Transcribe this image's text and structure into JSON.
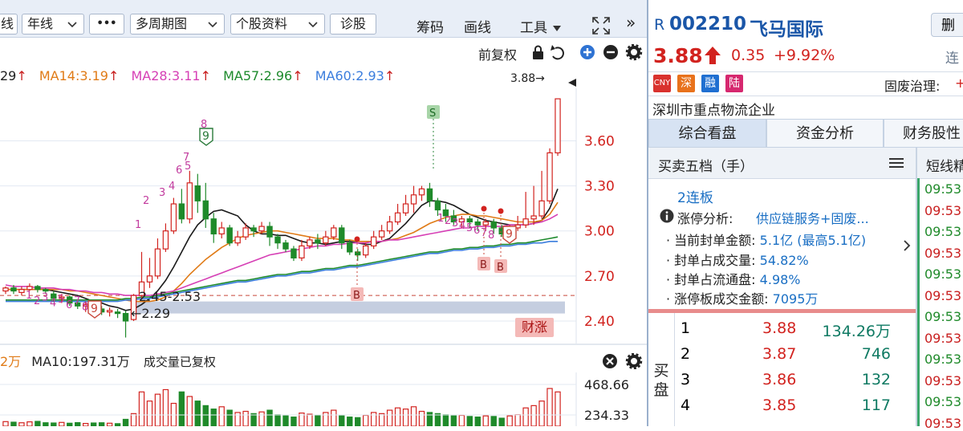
{
  "toolbar": {
    "btn_line_partial": "线",
    "btn_year_line": "年线",
    "btn_more": "•••",
    "btn_multi_period": "多周期图",
    "btn_stock_info": "个股资料",
    "btn_diagnose": "诊股",
    "btn_chips": "筹码",
    "btn_draw": "画线",
    "btn_tools": "工具",
    "btn_collapse": "»"
  },
  "chart_toggle": {
    "restore_label": "前复权"
  },
  "ma": {
    "ma7_partial": "29",
    "ma14": "MA14:3.19",
    "ma28": "MA28:3.11",
    "ma57": "MA57:2.96",
    "ma60": "MA60:2.93",
    "colors": {
      "ma14": "#e07b17",
      "ma28": "#d63fb5",
      "ma57": "#1d8a2c",
      "ma60": "#3b7ddd"
    }
  },
  "price_axis": {
    "ticks": [
      "3.60",
      "3.30",
      "3.00",
      "2.70",
      "2.40"
    ],
    "last_price_label": "3.88→"
  },
  "annotations": {
    "range_label": "2.45-2.53",
    "low_label": "←2.29",
    "cai_zhang": "财涨",
    "seq_left": [
      "1",
      "2",
      "3",
      "4",
      "5",
      "6",
      "7",
      "8",
      "9"
    ],
    "seq_rise": [
      "1",
      "2",
      "3",
      "4",
      "5",
      "6",
      "7",
      "8",
      "9"
    ],
    "seq_right": [
      "1",
      "2",
      "3",
      "4",
      "5",
      "6",
      "7",
      "8",
      "9"
    ],
    "signal_s": "S",
    "signal_b": "B"
  },
  "volume": {
    "ma5_partial": "2万",
    "ma10": "MA10:197.31万",
    "note": "成交量已复权",
    "axis_ticks": [
      "468.66",
      "234.33"
    ]
  },
  "quote": {
    "r_mark": "R",
    "code": "002210",
    "name": "飞马国际",
    "btn_delete": "删",
    "price": "3.88",
    "change": "0.35",
    "change_pct": "+9.92%",
    "lianban_partial": "连",
    "badges": [
      {
        "text": "CNY",
        "color": "#d9322e"
      },
      {
        "text": "深",
        "color": "#e8721c"
      },
      {
        "text": "融",
        "color": "#1f6fd1"
      },
      {
        "text": "陆",
        "color": "#d6286f"
      }
    ],
    "governance_label": "固废治理:",
    "governance_partial": "+",
    "industry": "深圳市重点物流企业"
  },
  "tabs": [
    {
      "label": "综合看盘"
    },
    {
      "label": "资金分析"
    },
    {
      "label": "财务股性"
    }
  ],
  "depth": {
    "title": "买卖五档（手）",
    "lianban": "2连板",
    "limit_analysis_label": "涨停分析:",
    "limit_analysis_value": "供应链服务+固废...",
    "details": [
      {
        "label": "· 当前封单金额:",
        "value": "5.1亿 (最高5.1亿)"
      },
      {
        "label": "· 封单占成交量:",
        "value": "54.82%"
      },
      {
        "label": "· 封单占流通盘:",
        "value": "4.98%"
      },
      {
        "label": "· 涨停板成交金额:",
        "value": "7095万"
      }
    ],
    "buy_side_label": "买盘",
    "orders": [
      {
        "level": "1",
        "price": "3.88",
        "volume": "134.26万"
      },
      {
        "level": "2",
        "price": "3.87",
        "volume": "746"
      },
      {
        "level": "3",
        "price": "3.86",
        "volume": "132"
      },
      {
        "level": "4",
        "price": "3.85",
        "volume": "117"
      }
    ]
  },
  "ticks": {
    "title": "短线精",
    "times": [
      "09:53:",
      "09:53:",
      "09:53:",
      "09:53:",
      "09:53:",
      "09:53:",
      "09:53:",
      "09:53:",
      "09:53:",
      "09:53:",
      "09:53:",
      "09:53:"
    ]
  },
  "chart_data": {
    "type": "candlestick",
    "y_range": [
      2.25,
      3.95
    ],
    "candles": [
      [
        2.6,
        2.62,
        2.58,
        2.63
      ],
      [
        2.62,
        2.6,
        2.58,
        2.64
      ],
      [
        2.59,
        2.61,
        2.57,
        2.63
      ],
      [
        2.61,
        2.63,
        2.6,
        2.65
      ],
      [
        2.63,
        2.61,
        2.59,
        2.64
      ],
      [
        2.61,
        2.6,
        2.58,
        2.62
      ],
      [
        2.58,
        2.55,
        2.53,
        2.6
      ],
      [
        2.55,
        2.56,
        2.52,
        2.58
      ],
      [
        2.56,
        2.52,
        2.5,
        2.57
      ],
      [
        2.52,
        2.5,
        2.48,
        2.54
      ],
      [
        2.5,
        2.51,
        2.46,
        2.53
      ],
      [
        2.51,
        2.48,
        2.45,
        2.52
      ],
      [
        2.48,
        2.46,
        2.44,
        2.5
      ],
      [
        2.46,
        2.47,
        2.43,
        2.49
      ],
      [
        2.46,
        2.45,
        2.42,
        2.48
      ],
      [
        2.45,
        2.4,
        2.29,
        2.47
      ],
      [
        2.41,
        2.57,
        2.4,
        2.58
      ],
      [
        2.57,
        2.66,
        2.55,
        2.86
      ],
      [
        2.66,
        2.7,
        2.62,
        2.82
      ],
      [
        2.7,
        2.88,
        2.68,
        2.95
      ],
      [
        2.88,
        3.0,
        2.86,
        3.05
      ],
      [
        3.0,
        3.18,
        2.98,
        3.22
      ],
      [
        3.18,
        3.08,
        3.05,
        3.28
      ],
      [
        3.08,
        3.32,
        3.05,
        3.4
      ],
      [
        3.3,
        3.2,
        3.12,
        3.38
      ],
      [
        3.2,
        3.08,
        3.02,
        3.32
      ],
      [
        3.08,
        2.98,
        2.92,
        3.12
      ],
      [
        2.98,
        3.02,
        2.95,
        3.06
      ],
      [
        3.02,
        2.92,
        2.9,
        3.04
      ],
      [
        2.92,
        2.96,
        2.9,
        3.0
      ],
      [
        2.96,
        3.02,
        2.94,
        3.05
      ],
      [
        3.02,
        3.0,
        2.96,
        3.04
      ],
      [
        3.0,
        3.03,
        2.98,
        3.06
      ],
      [
        3.03,
        2.96,
        2.9,
        3.06
      ],
      [
        2.96,
        2.92,
        2.88,
        2.98
      ],
      [
        2.92,
        2.88,
        2.86,
        2.94
      ],
      [
        2.88,
        2.82,
        2.8,
        2.9
      ],
      [
        2.82,
        2.9,
        2.8,
        2.94
      ],
      [
        2.9,
        2.94,
        2.88,
        2.96
      ],
      [
        2.94,
        2.92,
        2.88,
        2.98
      ],
      [
        2.92,
        2.96,
        2.9,
        3.0
      ],
      [
        2.96,
        3.02,
        2.94,
        3.04
      ],
      [
        3.02,
        2.92,
        2.88,
        3.04
      ],
      [
        2.92,
        2.86,
        2.84,
        2.94
      ],
      [
        2.86,
        2.84,
        2.8,
        2.88
      ],
      [
        2.84,
        2.9,
        2.82,
        2.92
      ],
      [
        2.9,
        2.96,
        2.88,
        3.0
      ],
      [
        2.96,
        3.0,
        2.94,
        3.04
      ],
      [
        3.0,
        3.06,
        2.98,
        3.1
      ],
      [
        3.06,
        3.12,
        3.04,
        3.18
      ],
      [
        3.12,
        3.18,
        3.1,
        3.24
      ],
      [
        3.18,
        3.24,
        3.12,
        3.3
      ],
      [
        3.24,
        3.28,
        3.2,
        3.3
      ],
      [
        3.28,
        3.2,
        3.16,
        3.32
      ],
      [
        3.2,
        3.14,
        3.1,
        3.22
      ],
      [
        3.14,
        3.1,
        3.06,
        3.18
      ],
      [
        3.1,
        3.06,
        3.04,
        3.14
      ],
      [
        3.06,
        3.08,
        3.02,
        3.1
      ],
      [
        3.08,
        3.06,
        3.02,
        3.1
      ],
      [
        3.06,
        3.04,
        3.0,
        3.08
      ],
      [
        3.04,
        3.06,
        3.0,
        3.08
      ],
      [
        3.06,
        3.02,
        2.98,
        3.08
      ],
      [
        3.02,
        2.98,
        2.96,
        3.04
      ],
      [
        2.98,
        3.02,
        2.96,
        3.04
      ],
      [
        3.02,
        3.04,
        3.0,
        3.1
      ],
      [
        3.04,
        3.08,
        3.02,
        3.26
      ],
      [
        3.08,
        3.1,
        3.04,
        3.3
      ],
      [
        3.1,
        3.2,
        3.08,
        3.4
      ],
      [
        3.2,
        3.52,
        3.18,
        3.55
      ],
      [
        3.52,
        3.88,
        3.5,
        3.88
      ]
    ],
    "volume_axis_max": 520,
    "volumes": [
      40,
      35,
      30,
      38,
      42,
      30,
      28,
      33,
      26,
      31,
      24,
      28,
      30,
      26,
      22,
      60,
      110,
      300,
      220,
      280,
      320,
      200,
      300,
      260,
      220,
      180,
      150,
      170,
      140,
      120,
      130,
      110,
      125,
      140,
      100,
      90,
      80,
      115,
      105,
      95,
      120,
      140,
      90,
      80,
      75,
      95,
      120,
      110,
      140,
      160,
      150,
      170,
      130,
      120,
      110,
      100,
      90,
      95,
      85,
      80,
      90,
      85,
      70,
      90,
      100,
      160,
      180,
      220,
      330,
      300
    ],
    "ma_series": {
      "ma7": [
        2.61,
        2.61,
        2.61,
        2.61,
        2.61,
        2.61,
        2.6,
        2.59,
        2.58,
        2.57,
        2.55,
        2.53,
        2.52,
        2.5,
        2.49,
        2.47,
        2.48,
        2.51,
        2.55,
        2.6,
        2.67,
        2.76,
        2.86,
        2.96,
        3.04,
        3.09,
        3.13,
        3.14,
        3.12,
        3.1,
        3.04,
        3.0,
        2.98,
        2.98,
        2.97,
        2.97,
        2.95,
        2.93,
        2.92,
        2.92,
        2.91,
        2.92,
        2.93,
        2.93,
        2.92,
        2.91,
        2.91,
        2.93,
        2.95,
        3.0,
        3.05,
        3.11,
        3.17,
        3.2,
        3.2,
        3.19,
        3.17,
        3.14,
        3.11,
        3.09,
        3.07,
        3.06,
        3.05,
        3.04,
        3.04,
        3.04,
        3.05,
        3.07,
        3.15,
        3.28
      ],
      "ma14": [
        2.61,
        2.61,
        2.61,
        2.61,
        2.61,
        2.61,
        2.61,
        2.61,
        2.6,
        2.6,
        2.59,
        2.58,
        2.57,
        2.56,
        2.55,
        2.54,
        2.53,
        2.53,
        2.53,
        2.54,
        2.56,
        2.6,
        2.65,
        2.71,
        2.76,
        2.81,
        2.85,
        2.89,
        2.92,
        2.95,
        2.97,
        2.98,
        2.99,
        3.0,
        3.0,
        2.99,
        2.98,
        2.97,
        2.96,
        2.95,
        2.95,
        2.95,
        2.94,
        2.94,
        2.93,
        2.93,
        2.93,
        2.93,
        2.94,
        2.95,
        2.97,
        2.99,
        3.02,
        3.05,
        3.07,
        3.09,
        3.1,
        3.11,
        3.11,
        3.1,
        3.1,
        3.09,
        3.08,
        3.07,
        3.06,
        3.06,
        3.06,
        3.07,
        3.11,
        3.19
      ],
      "ma28": [
        2.64,
        2.63,
        2.63,
        2.63,
        2.62,
        2.62,
        2.62,
        2.61,
        2.61,
        2.6,
        2.6,
        2.59,
        2.59,
        2.58,
        2.58,
        2.57,
        2.57,
        2.57,
        2.57,
        2.58,
        2.59,
        2.6,
        2.62,
        2.64,
        2.66,
        2.68,
        2.7,
        2.72,
        2.74,
        2.76,
        2.78,
        2.8,
        2.82,
        2.84,
        2.85,
        2.86,
        2.87,
        2.88,
        2.89,
        2.9,
        2.9,
        2.91,
        2.91,
        2.92,
        2.92,
        2.92,
        2.93,
        2.93,
        2.94,
        2.94,
        2.95,
        2.96,
        2.97,
        2.98,
        2.99,
        3.0,
        3.01,
        3.02,
        3.02,
        3.03,
        3.03,
        3.03,
        3.03,
        3.04,
        3.04,
        3.04,
        3.05,
        3.06,
        3.08,
        3.11
      ],
      "ma57": [
        2.54,
        2.54,
        2.54,
        2.54,
        2.54,
        2.54,
        2.54,
        2.54,
        2.54,
        2.54,
        2.54,
        2.54,
        2.54,
        2.54,
        2.54,
        2.55,
        2.55,
        2.56,
        2.56,
        2.57,
        2.58,
        2.59,
        2.6,
        2.61,
        2.62,
        2.63,
        2.64,
        2.65,
        2.66,
        2.67,
        2.67,
        2.68,
        2.69,
        2.7,
        2.71,
        2.71,
        2.72,
        2.73,
        2.73,
        2.74,
        2.75,
        2.75,
        2.76,
        2.77,
        2.77,
        2.78,
        2.79,
        2.8,
        2.81,
        2.82,
        2.83,
        2.84,
        2.85,
        2.86,
        2.86,
        2.87,
        2.88,
        2.88,
        2.89,
        2.89,
        2.9,
        2.9,
        2.91,
        2.91,
        2.92,
        2.92,
        2.93,
        2.94,
        2.95,
        2.96
      ],
      "ma60": [
        2.53,
        2.53,
        2.53,
        2.53,
        2.53,
        2.53,
        2.53,
        2.53,
        2.53,
        2.53,
        2.53,
        2.53,
        2.53,
        2.53,
        2.53,
        2.54,
        2.54,
        2.55,
        2.55,
        2.56,
        2.57,
        2.58,
        2.59,
        2.6,
        2.61,
        2.62,
        2.63,
        2.64,
        2.65,
        2.66,
        2.66,
        2.67,
        2.68,
        2.69,
        2.7,
        2.7,
        2.71,
        2.72,
        2.72,
        2.73,
        2.74,
        2.74,
        2.75,
        2.76,
        2.76,
        2.77,
        2.78,
        2.79,
        2.8,
        2.81,
        2.82,
        2.83,
        2.84,
        2.85,
        2.85,
        2.86,
        2.87,
        2.87,
        2.88,
        2.88,
        2.89,
        2.89,
        2.9,
        2.9,
        2.91,
        2.91,
        2.92,
        2.92,
        2.93,
        2.93
      ]
    },
    "support_band": [
      2.45,
      2.53
    ],
    "dashed_level": 2.57
  }
}
